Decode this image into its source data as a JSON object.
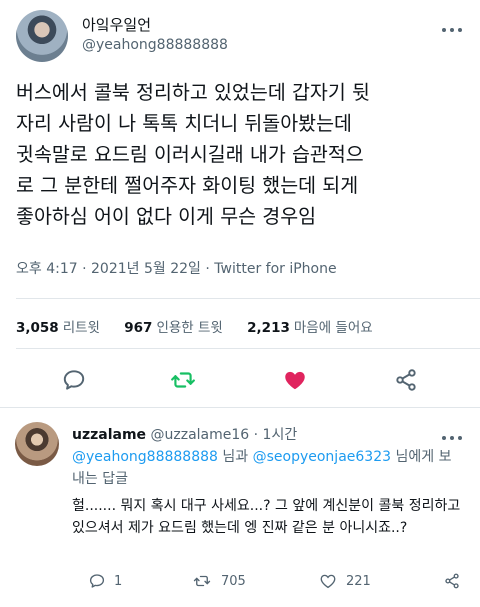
{
  "author": {
    "display_name": "아잌우일언",
    "handle": "@yeahong88888888",
    "avatar_icon": "profile-photo"
  },
  "tweet": {
    "text": "버스에서 콜북 정리하고 있었는데 갑자기 뒷\n자리 사람이 나 톡톡 치더니 뒤돌아봤는데\n귓속말로 요드림 이러시길래 내가 습관적으\n로 그 분한테 쩔어주자 화이팅 했는데 되게\n좋아하심 어이 없다 이게 무슨 경우임",
    "time": "오후 4:17",
    "date": "2021년 5월 22일",
    "source": "Twitter for iPhone",
    "separator": "·"
  },
  "stats": {
    "retweets": "3,058",
    "retweets_label": "리트윗",
    "quotes": "967",
    "quotes_label": "인용한 트윗",
    "likes": "2,213",
    "likes_label": "마음에 들어요"
  },
  "actions": {
    "icons": [
      "reply-icon",
      "retweet-icon",
      "like-icon",
      "share-icon"
    ],
    "retweet_color": "#17bf63",
    "like_color": "#e0245e"
  },
  "reply": {
    "name": "uzzalame",
    "handle": "@uzzalame16",
    "separator": "·",
    "time": "1시간",
    "replying_mention_1": "@yeahong88888888",
    "replying_and": "님과",
    "replying_mention_2": "@seopyeonjae6323",
    "replying_tail": "님에게 보내는 답글",
    "text": "헐....... 뭐지 혹시 대구 사세요...? 그 앞에 계신분이 콜북 정리하고 있으셔서 제가 요드림 했는데 엥 진짜 같은 분 아니시죠..?",
    "reply_count": "1",
    "retweet_count": "705",
    "like_count": "221"
  },
  "colors": {
    "text": "#0f1419",
    "secondary": "#536471",
    "link": "#1d9bf0"
  }
}
